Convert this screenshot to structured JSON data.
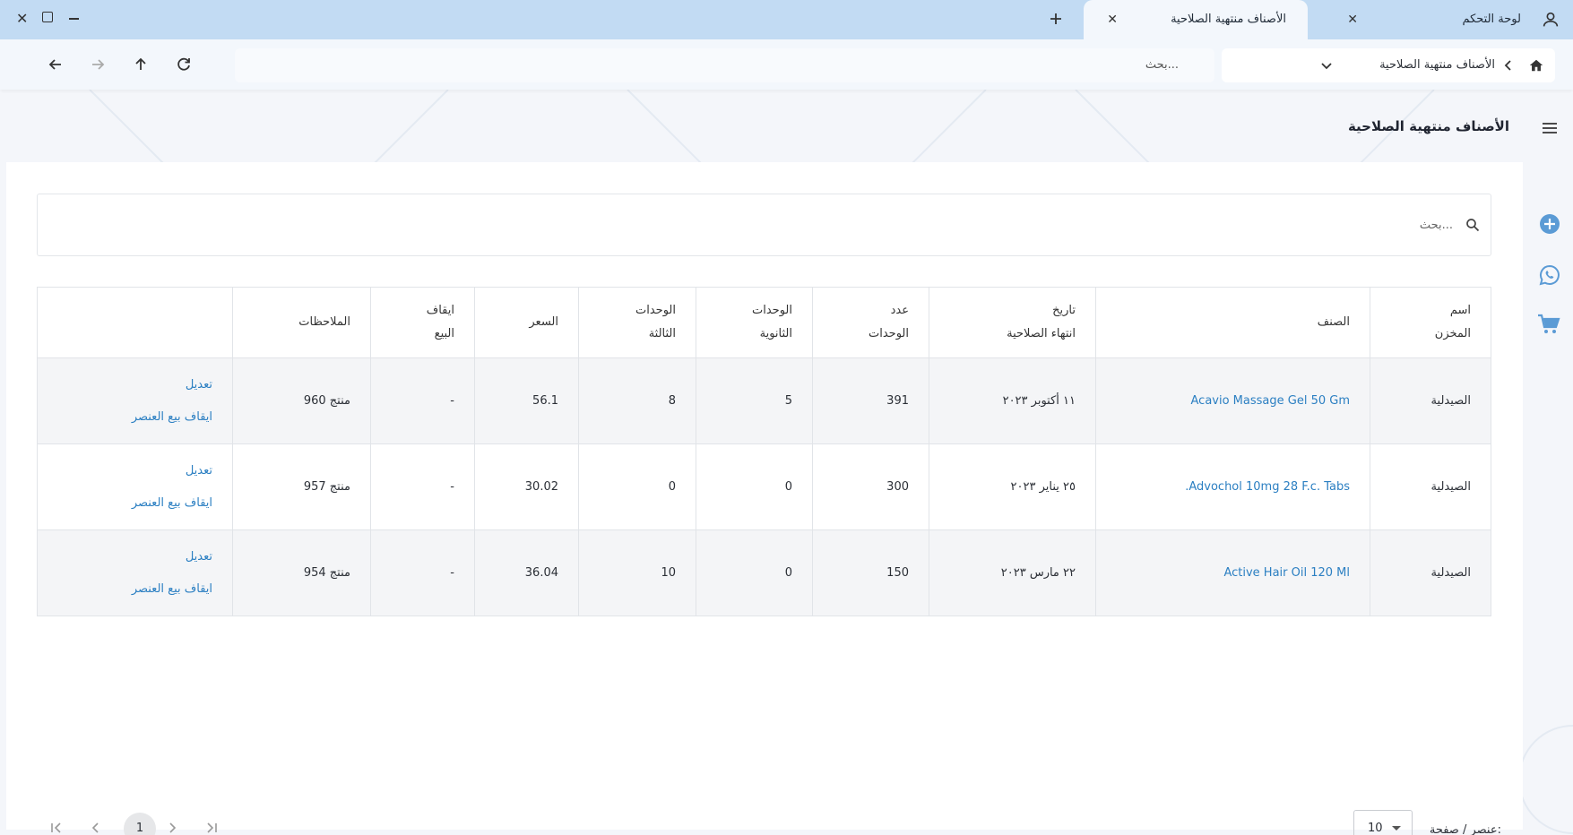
{
  "tabs": {
    "dashboard_label": "لوحة التحكم",
    "active_label": "الأصناف منتهية الصلاحية"
  },
  "navbar": {
    "breadcrumb": "الأصناف منتهية الصلاحية",
    "search_placeholder": "بحث..."
  },
  "page": {
    "title": "الأصناف منتهية الصلاحية",
    "search_placeholder": "بحث..."
  },
  "table": {
    "headers": {
      "store_line1": "اسم",
      "store_line2": "المخزن",
      "item": "الصنف",
      "expiry_line1": "تاريخ",
      "expiry_line2": "انتهاء الصلاحية",
      "units_line1": "عدد",
      "units_line2": "الوحدات",
      "secondary_line1": "الوحدات",
      "secondary_line2": "الثانوية",
      "tertiary_line1": "الوحدات",
      "tertiary_line2": "الثالثة",
      "price": "السعر",
      "stop_line1": "ايقاف",
      "stop_line2": "البيع",
      "notes": "الملاحظات"
    },
    "rows": [
      {
        "store": "الصيدلية",
        "item": "Acavio Massage Gel 50 Gm",
        "expiry": "١١ أكتوبر ٢٠٢٣",
        "units": "391",
        "secondary": "5",
        "tertiary": "8",
        "price": "56.1",
        "stop": "-",
        "notes": "منتج 960",
        "edit": "تعديل",
        "stop_sale": "ايقاف بيع العنصر"
      },
      {
        "store": "الصيدلية",
        "item": "Advochol 10mg 28 F.c. Tabs.",
        "expiry": "٢٥ يناير ٢٠٢٣",
        "units": "300",
        "secondary": "0",
        "tertiary": "0",
        "price": "30.02",
        "stop": "-",
        "notes": "منتج 957",
        "edit": "تعديل",
        "stop_sale": "ايقاف بيع العنصر"
      },
      {
        "store": "الصيدلية",
        "item": "Active Hair Oil 120 Ml",
        "expiry": "٢٢ مارس ٢٠٢٣",
        "units": "150",
        "secondary": "0",
        "tertiary": "10",
        "price": "36.04",
        "stop": "-",
        "notes": "منتج 954",
        "edit": "تعديل",
        "stop_sale": "ايقاف بيع العنصر"
      }
    ]
  },
  "pagination": {
    "per_page_label": "عنصر / صفحة:",
    "per_page_value": "10",
    "current_page": "1"
  },
  "colors": {
    "tabbar": "#c2dbf3",
    "link": "#2b7fc2",
    "side_icon": "#5b9bd5"
  },
  "icons": [
    "user-icon",
    "close-icon",
    "plus-icon",
    "back-arrow-icon",
    "forward-arrow-icon",
    "up-arrow-icon",
    "refresh-icon",
    "home-icon",
    "chevron-icon",
    "chevron-down-icon",
    "menu-icon",
    "search-icon",
    "add-circle-icon",
    "whatsapp-icon",
    "cart-icon",
    "first-page-icon",
    "prev-page-icon",
    "next-page-icon",
    "last-page-icon"
  ]
}
